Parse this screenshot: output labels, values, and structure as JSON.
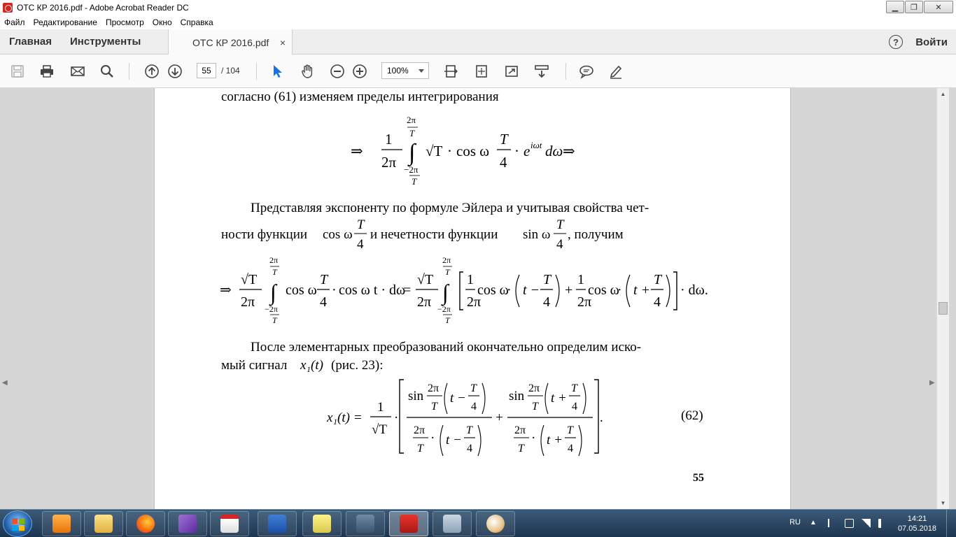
{
  "window": {
    "title": "ОТС КР 2016.pdf - Adobe Acrobat Reader DC"
  },
  "menu": {
    "items": [
      "Файл",
      "Редактирование",
      "Просмотр",
      "Окно",
      "Справка"
    ]
  },
  "tabs": {
    "home": "Главная",
    "tools": "Инструменты",
    "document": "ОТС КР 2016.pdf",
    "close": "×"
  },
  "account": {
    "help": "?",
    "sign_in": "Войти"
  },
  "toolbar": {
    "current_page": "55",
    "total_pages": "/ 104",
    "zoom": "100%"
  },
  "icons": [
    "save-icon",
    "print-icon",
    "email-icon",
    "search-icon",
    "page-up-icon",
    "page-down-icon",
    "select-arrow-icon",
    "hand-icon",
    "zoom-out-icon",
    "zoom-in-icon",
    "scrolling-mode-icon",
    "fit-page-icon",
    "full-screen-icon",
    "read-mode-icon",
    "comment-icon",
    "sign-icon"
  ],
  "page": {
    "line1": "согласно (61) изменяем пределы интегрирования",
    "para2_l1": "Представляя экспоненту по формуле Эйлера и учитывая свойства чет-",
    "para2_l2a": "ности функции ",
    "para2_l2b": " и нечетности функции ",
    "para2_l2c": ", получим",
    "para3_l1": "После элементарных преобразований окончательно определим иско-",
    "para3_l2a": "мый сигнал ",
    "para3_l2b": " (рис. 23):",
    "eq_number": "(62)",
    "page_number": "55"
  },
  "math": {
    "two_pi": "2π",
    "one": "1",
    "T": "T",
    "four": "4",
    "neg_2pi": "−2π",
    "sqrtT": "√T",
    "cosw": "cos ω",
    "sinw": "sin ω",
    "cos": "cos",
    "sin": "sin",
    "exp": "e",
    "exp_sup": "iωt",
    "domega": "dω",
    "domega_dot": "· dω.",
    "implies": "⇒",
    "dot": "·",
    "eq": "=",
    "plus": "+",
    "minus": "−",
    "coswt_dt": "cos ω t · dω",
    "x1t": "x₁(t)",
    "x1t_eq": "x₁(t) =",
    "t_minus": "t −",
    "t_plus": "t +",
    "integral": "∫",
    "period": "."
  },
  "taskbar": {
    "apps": [
      "media-player-icon",
      "file-explorer-icon",
      "firefox-icon",
      "visual-studio-icon",
      "calendar-321-icon",
      "word-icon",
      "sticky-notes-icon",
      "mathcad-icon",
      "acrobat-icon",
      "calculator-icon",
      "paint-icon"
    ],
    "language": "RU",
    "time": "14:21",
    "date": "07.05.2018"
  }
}
